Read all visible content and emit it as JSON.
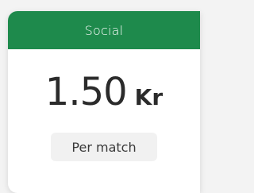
{
  "plan": {
    "name": "Social",
    "price": "1.50",
    "currency": "Kr",
    "period": "Per match"
  },
  "colors": {
    "header": "#1e8a4c",
    "card": "#ffffff",
    "badge": "#f1f1f1",
    "text": "#2b2b2b"
  }
}
